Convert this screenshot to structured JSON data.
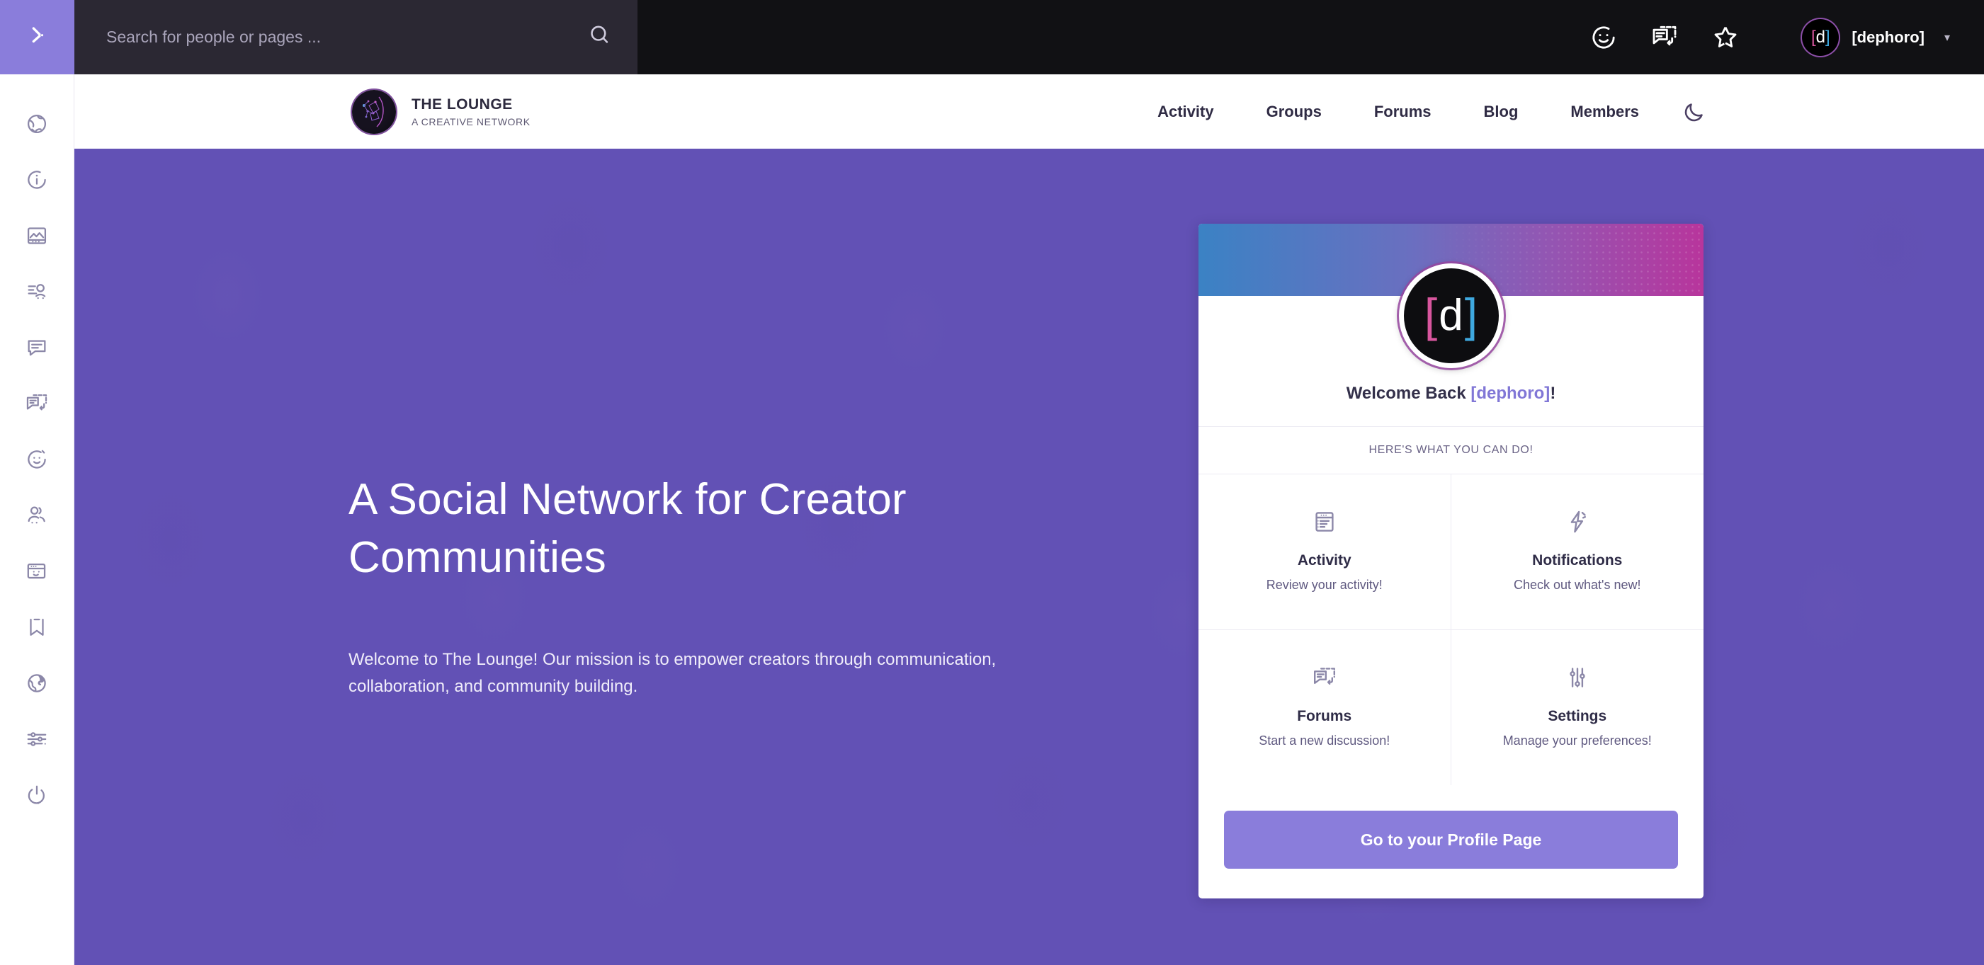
{
  "adminbar": {
    "collapse_icon": "chevron-right-icon",
    "search": {
      "placeholder": "Search for people or pages ...",
      "value": "",
      "icon": "search-icon"
    },
    "icons": [
      {
        "name": "smiley-icon",
        "label": "Emoji"
      },
      {
        "name": "messages-icon",
        "label": "Messages"
      },
      {
        "name": "star-icon",
        "label": "Favorites"
      }
    ],
    "user": {
      "name": "[dephoro]",
      "avatar_bracket_left": "[",
      "avatar_letter": "d",
      "avatar_bracket_right": "]",
      "caret": "chevron-down-icon"
    }
  },
  "sidebar": {
    "items": [
      {
        "icon": "globe-network-icon",
        "label": "Network"
      },
      {
        "icon": "info-circle-icon",
        "label": "Info"
      },
      {
        "icon": "image-icon",
        "label": "Media"
      },
      {
        "icon": "profile-settings-icon",
        "label": "Profile"
      },
      {
        "icon": "comment-icon",
        "label": "Comments"
      },
      {
        "icon": "forum-icon",
        "label": "Forums"
      },
      {
        "icon": "smiley-icon",
        "label": "Emoji"
      },
      {
        "icon": "groups-icon",
        "label": "Groups"
      },
      {
        "icon": "blog-window-icon",
        "label": "Blog"
      },
      {
        "icon": "bookmark-icon",
        "label": "Bookmarks"
      },
      {
        "icon": "globe-icon",
        "label": "Global"
      },
      {
        "icon": "sliders-icon",
        "label": "Settings"
      },
      {
        "icon": "power-icon",
        "label": "Logout"
      }
    ]
  },
  "siteheader": {
    "brand": {
      "title": "THE LOUNGE",
      "subtitle": "A CREATIVE NETWORK",
      "logo_icon": "network-head-logo"
    },
    "nav": [
      {
        "label": "Activity"
      },
      {
        "label": "Groups"
      },
      {
        "label": "Forums"
      },
      {
        "label": "Blog"
      },
      {
        "label": "Members"
      }
    ],
    "darkmode_icon": "moon-icon"
  },
  "hero": {
    "title": "A Social Network for Creator Communities",
    "subtitle": "Welcome to The Lounge! Our mission is to empower creators through communication, collaboration, and community building.",
    "background_color": "#6251b5"
  },
  "card": {
    "cover_gradient_from": "#3b82c4",
    "cover_gradient_to": "#b8359c",
    "avatar": {
      "bracket_left": "[",
      "letter": "d",
      "bracket_right": "]"
    },
    "welcome_prefix": "Welcome Back ",
    "welcome_username": "[dephoro]",
    "welcome_suffix": "!",
    "strip_label": "HERE'S WHAT YOU CAN DO!",
    "tiles": [
      {
        "icon": "activity-icon",
        "title": "Activity",
        "desc": "Review your activity!"
      },
      {
        "icon": "notifications-icon",
        "title": "Notifications",
        "desc": "Check out what's new!"
      },
      {
        "icon": "forums-icon",
        "title": "Forums",
        "desc": "Start a new discussion!"
      },
      {
        "icon": "settings-sliders-icon",
        "title": "Settings",
        "desc": "Manage your preferences!"
      }
    ],
    "cta_label": "Go to your Profile Page",
    "cta_color": "#8a7ddb"
  }
}
